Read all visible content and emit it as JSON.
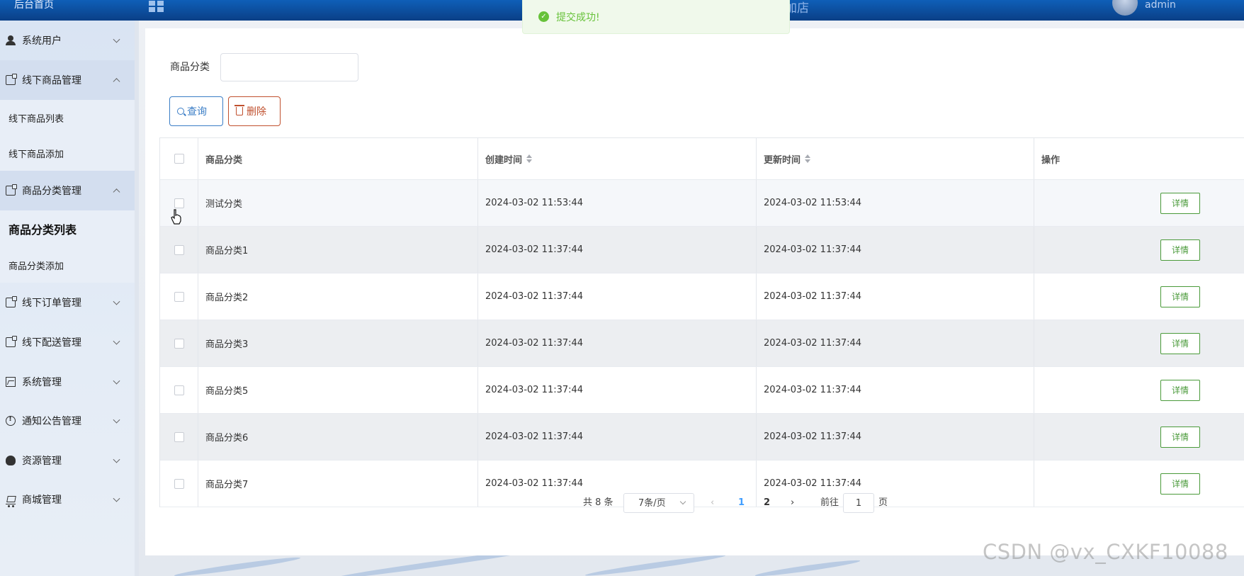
{
  "topbar": {
    "home_label": "后台首页",
    "app_title": "加店",
    "username": "admin"
  },
  "toast": {
    "message": "提交成功!"
  },
  "sidebar": {
    "items": [
      {
        "label": "系统用户",
        "icon": "user-icon",
        "open": false
      },
      {
        "label": "线下商品管理",
        "icon": "document-icon",
        "open": true,
        "children": [
          {
            "label": "线下商品列表"
          },
          {
            "label": "线下商品添加"
          }
        ]
      },
      {
        "label": "商品分类管理",
        "icon": "document-icon",
        "open": true,
        "children": [
          {
            "label": "商品分类列表",
            "active": true
          },
          {
            "label": "商品分类添加"
          }
        ]
      },
      {
        "label": "线下订单管理",
        "icon": "document-icon",
        "open": false
      },
      {
        "label": "线下配送管理",
        "icon": "document-icon",
        "open": false
      },
      {
        "label": "系统管理",
        "icon": "picture-icon",
        "open": false
      },
      {
        "label": "通知公告管理",
        "icon": "info-icon",
        "open": false
      },
      {
        "label": "资源管理",
        "icon": "bulb-icon",
        "open": false
      },
      {
        "label": "商城管理",
        "icon": "cart-icon",
        "open": false
      }
    ]
  },
  "filter": {
    "label": "商品分类",
    "value": "",
    "placeholder": ""
  },
  "actions": {
    "query_label": "查询",
    "delete_label": "删除"
  },
  "table": {
    "columns": [
      "商品分类",
      "创建时间",
      "更新时间",
      "操作"
    ],
    "detail_label": "详情",
    "rows": [
      {
        "name": "测试分类",
        "created": "2024-03-02 11:53:44",
        "updated": "2024-03-02 11:53:44"
      },
      {
        "name": "商品分类1",
        "created": "2024-03-02 11:37:44",
        "updated": "2024-03-02 11:37:44"
      },
      {
        "name": "商品分类2",
        "created": "2024-03-02 11:37:44",
        "updated": "2024-03-02 11:37:44"
      },
      {
        "name": "商品分类3",
        "created": "2024-03-02 11:37:44",
        "updated": "2024-03-02 11:37:44"
      },
      {
        "name": "商品分类5",
        "created": "2024-03-02 11:37:44",
        "updated": "2024-03-02 11:37:44"
      },
      {
        "name": "商品分类6",
        "created": "2024-03-02 11:37:44",
        "updated": "2024-03-02 11:37:44"
      },
      {
        "name": "商品分类7",
        "created": "2024-03-02 11:37:44",
        "updated": "2024-03-02 11:37:44"
      }
    ]
  },
  "pagination": {
    "total_text": "共 8 条",
    "page_size": "7条/页",
    "pages": [
      "1",
      "2"
    ],
    "current_page": "1",
    "goto_label": "前往",
    "goto_value": "1",
    "page_unit": "页"
  },
  "watermark": "CSDN @vx_CXKF10088",
  "colors": {
    "topbar": "#0a4fa0",
    "primary": "#409eff",
    "success": "#67c23a",
    "danger": "#c0502e",
    "detail": "#4a9a3a"
  }
}
